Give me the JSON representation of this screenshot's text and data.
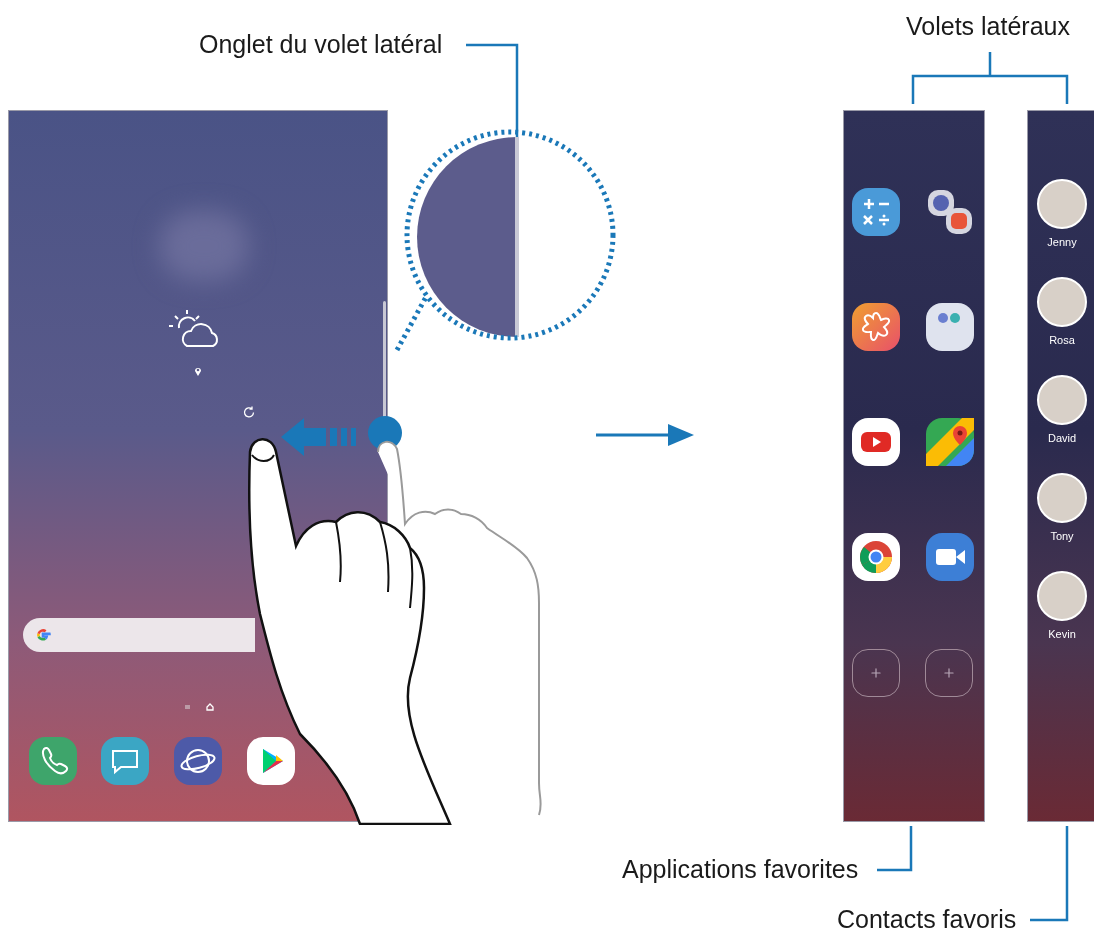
{
  "callouts": {
    "edge_handle": "Onglet du volet latéral",
    "edge_panels": "Volets latéraux",
    "apps_edge": "Applications favorites",
    "people_edge": "Contacts favoris"
  },
  "people_edge": {
    "contacts": [
      {
        "name": "Jenny"
      },
      {
        "name": "Rosa"
      },
      {
        "name": "David"
      },
      {
        "name": "Tony"
      },
      {
        "name": "Kevin"
      }
    ]
  }
}
